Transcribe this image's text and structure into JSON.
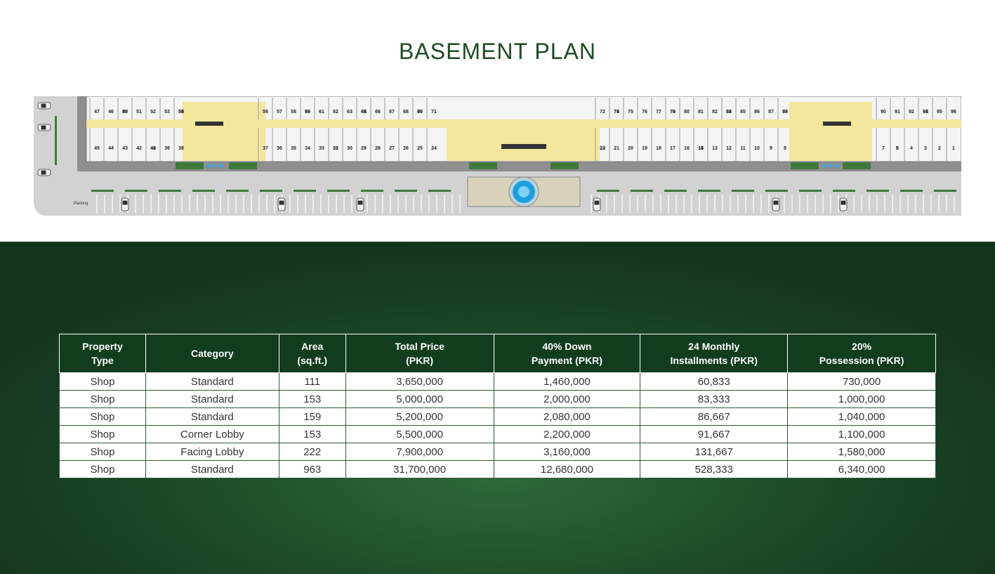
{
  "header": {
    "title": "BASEMENT PLAN"
  },
  "plan": {
    "parking_label": "Parking",
    "top_row_units": [
      "47",
      "46",
      "48",
      "50",
      "51",
      "52",
      "53",
      "54",
      "55",
      "56",
      "57",
      "58",
      "59",
      "60",
      "61",
      "62",
      "63",
      "64",
      "65",
      "66",
      "67",
      "68",
      "69",
      "70",
      "71",
      "72",
      "73",
      "74",
      "75",
      "76",
      "77",
      "78",
      "79",
      "80",
      "81",
      "82",
      "83",
      "84",
      "85",
      "86",
      "87",
      "88",
      "89",
      "90",
      "91",
      "92",
      "93",
      "94",
      "95",
      "96"
    ],
    "bottom_row_units": [
      "45",
      "44",
      "43",
      "42",
      "41",
      "40",
      "39",
      "38",
      "37",
      "36",
      "35",
      "34",
      "33",
      "32",
      "31",
      "30",
      "29",
      "28",
      "27",
      "26",
      "25",
      "24",
      "23",
      "22",
      "21",
      "20",
      "19",
      "18",
      "17",
      "16",
      "15",
      "14",
      "13",
      "12",
      "11",
      "10",
      "9",
      "8",
      "7",
      "6",
      "5",
      "4",
      "3",
      "2",
      "1"
    ]
  },
  "table": {
    "headers": [
      [
        "Property",
        "Type"
      ],
      [
        "Category",
        ""
      ],
      [
        "Area",
        "(sq.ft.)"
      ],
      [
        "Total Price",
        "(PKR)"
      ],
      [
        "40% Down",
        "Payment (PKR)"
      ],
      [
        "24 Monthly",
        "Installments (PKR)"
      ],
      [
        "20%",
        "Possession (PKR)"
      ]
    ],
    "rows": [
      [
        "Shop",
        "Standard",
        "111",
        "3,650,000",
        "1,460,000",
        "60,833",
        "730,000"
      ],
      [
        "Shop",
        "Standard",
        "153",
        "5,000,000",
        "2,000,000",
        "83,333",
        "1,000,000"
      ],
      [
        "Shop",
        "Standard",
        "159",
        "5,200,000",
        "2,080,000",
        "86,667",
        "1,040,000"
      ],
      [
        "Shop",
        "Corner Lobby",
        "153",
        "5,500,000",
        "2,200,000",
        "91,667",
        "1,100,000"
      ],
      [
        "Shop",
        "Facing Lobby",
        "222",
        "7,900,000",
        "3,160,000",
        "131,667",
        "1,580,000"
      ],
      [
        "Shop",
        "Standard",
        "963",
        "31,700,000",
        "12,680,000",
        "528,333",
        "6,340,000"
      ]
    ]
  }
}
